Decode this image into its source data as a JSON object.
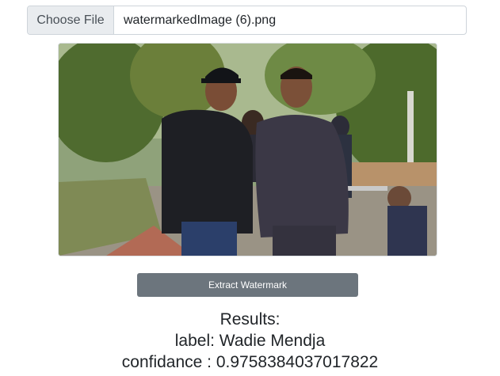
{
  "file_input": {
    "button_label": "Choose File",
    "file_name": "watermarkedImage (6).png"
  },
  "image": {
    "icon": "photo-two-men-outdoors"
  },
  "extract_button": {
    "label": "Extract Watermark"
  },
  "results": {
    "heading": "Results:",
    "label_line": "label: Wadie Mendja",
    "confidence_line": "confidance : 0.9758384037017822"
  },
  "colors": {
    "button_gray": "#6c757d",
    "file_button_bg": "#e9ecef",
    "border": "#ced4da"
  }
}
